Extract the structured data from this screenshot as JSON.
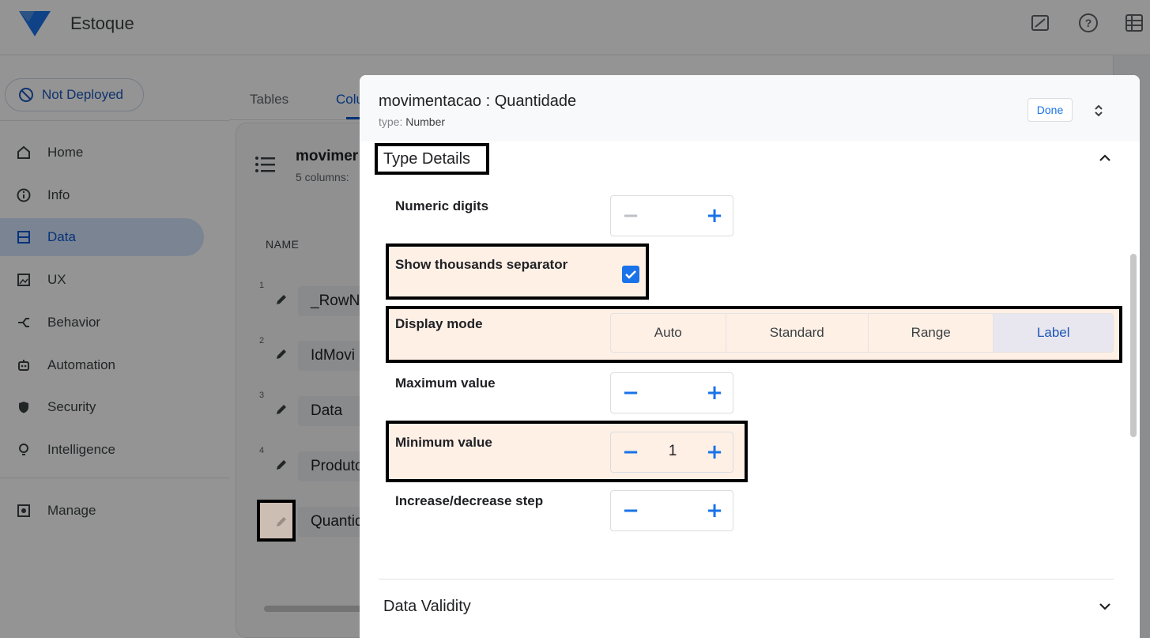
{
  "app": {
    "title": "Estoque",
    "deploy_status": "Not Deployed"
  },
  "sidebar": {
    "items": [
      {
        "label": "Home",
        "icon": "home-icon"
      },
      {
        "label": "Info",
        "icon": "info-icon"
      },
      {
        "label": "Data",
        "icon": "data-icon",
        "active": true
      },
      {
        "label": "UX",
        "icon": "ux-icon"
      },
      {
        "label": "Behavior",
        "icon": "behavior-icon"
      },
      {
        "label": "Automation",
        "icon": "automation-icon"
      },
      {
        "label": "Security",
        "icon": "shield-icon"
      },
      {
        "label": "Intelligence",
        "icon": "lightbulb-icon"
      },
      {
        "label": "Manage",
        "icon": "manage-icon"
      }
    ]
  },
  "tabs": [
    "Tables",
    "Colu"
  ],
  "table": {
    "name": "movimer",
    "subtitle": "5 columns:",
    "column_header": "NAME",
    "rows": [
      {
        "num": "1",
        "name": "_RowN"
      },
      {
        "num": "2",
        "name": "IdMovi"
      },
      {
        "num": "3",
        "name": "Data"
      },
      {
        "num": "4",
        "name": "Produto"
      },
      {
        "num": "",
        "name": "Quantid"
      }
    ]
  },
  "dialog": {
    "title": "movimentacao : Quantidade",
    "type_label": "type:",
    "type_value": "Number",
    "done_label": "Done",
    "type_details_title": "Type Details",
    "numeric_digits": {
      "label": "Numeric digits",
      "value": ""
    },
    "thousands_separator": {
      "label": "Show thousands separator",
      "checked": true
    },
    "display_mode": {
      "label": "Display mode",
      "options": [
        "Auto",
        "Standard",
        "Range",
        "Label"
      ],
      "selected": "Label"
    },
    "maximum_value": {
      "label": "Maximum value",
      "value": ""
    },
    "minimum_value": {
      "label": "Minimum value",
      "value": "1"
    },
    "step": {
      "label": "Increase/decrease step",
      "value": ""
    },
    "data_validity_title": "Data Validity",
    "stepper_minus": "−",
    "stepper_plus": "+"
  },
  "colors": {
    "accent": "#1a73e8",
    "highlight": "#ffe4d2",
    "overlay": "#000000"
  }
}
